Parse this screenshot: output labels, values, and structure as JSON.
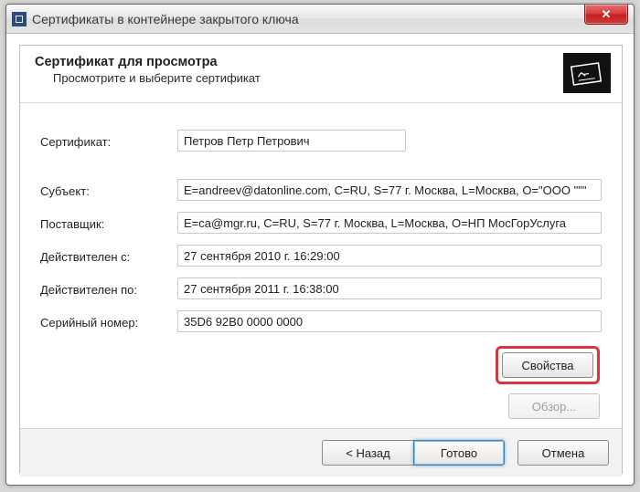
{
  "window": {
    "title": "Сертификаты в контейнере закрытого ключа",
    "close_glyph": "✕"
  },
  "wizard": {
    "title": "Сертификат для просмотра",
    "subtitle": "Просмотрите и выберите сертификат"
  },
  "labels": {
    "certificate": "Сертификат:",
    "subject": "Субъект:",
    "issuer": "Поставщик:",
    "valid_from": "Действителен с:",
    "valid_to": "Действителен по:",
    "serial": "Серийный номер:"
  },
  "values": {
    "certificate": "Петров Петр Петрович",
    "subject": "E=andreev@datonline.com, C=RU, S=77 г. Москва, L=Москва, O=\"ООО \"\"\"",
    "issuer": "E=ca@mgr.ru, C=RU, S=77 г. Москва, L=Москва, O=НП МосГорУслуга",
    "valid_from": "27 сентября 2010 г. 16:29:00",
    "valid_to": "27 сентября 2011 г. 16:38:00",
    "serial": "35D6 92B0 0000 0000"
  },
  "buttons": {
    "properties": "Свойства",
    "browse": "Обзор...",
    "back": "< Назад",
    "finish": "Готово",
    "cancel": "Отмена"
  }
}
